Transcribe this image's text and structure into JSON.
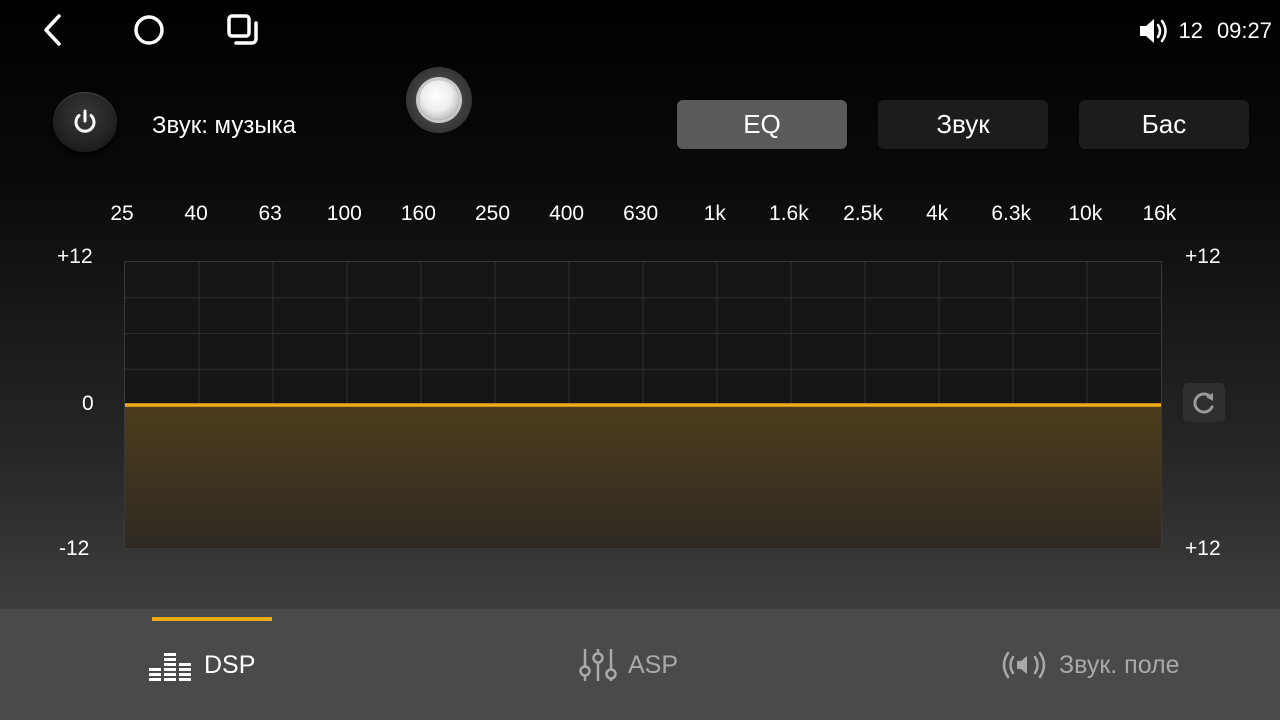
{
  "status_bar": {
    "volume": "12",
    "time": "09:27"
  },
  "header": {
    "sound_label": "Звук: музыка",
    "tabs": [
      "EQ",
      "Звук",
      "Бас"
    ],
    "active_tab": "EQ"
  },
  "eq": {
    "bands": [
      "25",
      "40",
      "63",
      "100",
      "160",
      "250",
      "400",
      "630",
      "1k",
      "1.6k",
      "2.5k",
      "4k",
      "6.3k",
      "10k",
      "16k"
    ],
    "gains_db": [
      0,
      0,
      0,
      0,
      0,
      0,
      0,
      0,
      0,
      0,
      0,
      0,
      0,
      0,
      0
    ],
    "scale_top": "+12",
    "scale_mid": "0",
    "scale_bottom_left": "-12",
    "scale_bottom_right": "+12",
    "range_db": [
      -12,
      12
    ],
    "curve_color": "#f1ad19"
  },
  "bottom_tabs": {
    "items": [
      "DSP",
      "ASP",
      "Звук. поле"
    ],
    "active": "DSP"
  },
  "icons": [
    "back-icon",
    "home-icon",
    "recents-icon",
    "volume-icon",
    "power-icon",
    "reset-icon",
    "equalizer-icon",
    "mixer-icon",
    "surround-icon"
  ]
}
